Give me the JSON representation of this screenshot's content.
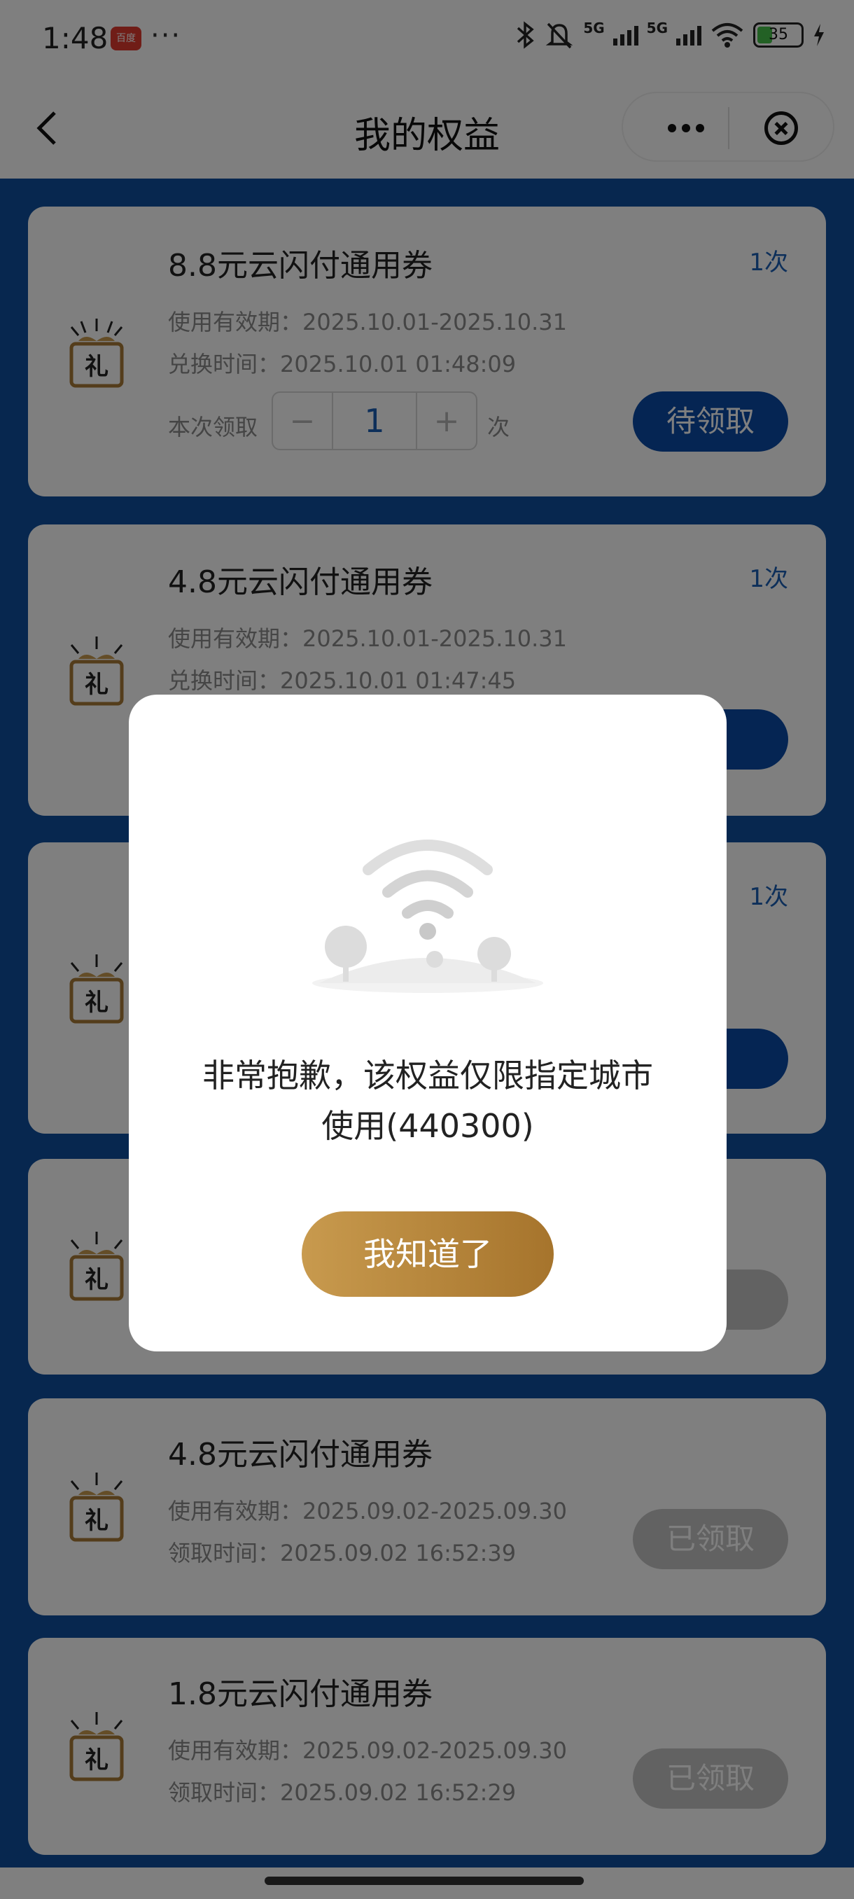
{
  "status_bar": {
    "time": "1:48",
    "app_badge": "百度",
    "more": "···",
    "network": "5G",
    "network2": "5G",
    "battery": "35"
  },
  "nav": {
    "title": "我的权益"
  },
  "cards": [
    {
      "title": "8.8元云闪付通用券",
      "count": "1次",
      "validity": "使用有效期：2025.10.01-2025.10.31",
      "time": "兑换时间：2025.10.01 01:48:09",
      "stepper_label": "本次领取",
      "stepper_minus": "−",
      "stepper_value": "1",
      "stepper_plus": "+",
      "stepper_unit": "次",
      "button": "待领取"
    },
    {
      "title": "4.8元云闪付通用券",
      "count": "1次",
      "validity": "使用有效期：2025.10.01-2025.10.31",
      "time": "兑换时间：2025.10.01 01:47:45",
      "button": "取"
    },
    {
      "count": "1次",
      "button": "取"
    },
    {
      "button": "取"
    },
    {
      "title": "4.8元云闪付通用券",
      "validity": "使用有效期：2025.09.02-2025.09.30",
      "time": "领取时间：2025.09.02 16:52:39",
      "button": "已领取"
    },
    {
      "title": "1.8元云闪付通用券",
      "validity": "使用有效期：2025.09.02-2025.09.30",
      "time": "领取时间：2025.09.02 16:52:29",
      "button": "已领取"
    }
  ],
  "dialog": {
    "message_line1": "非常抱歉，该权益仅限指定城市",
    "message_line2": "使用(440300)",
    "button": "我知道了"
  },
  "gift_label": "礼"
}
